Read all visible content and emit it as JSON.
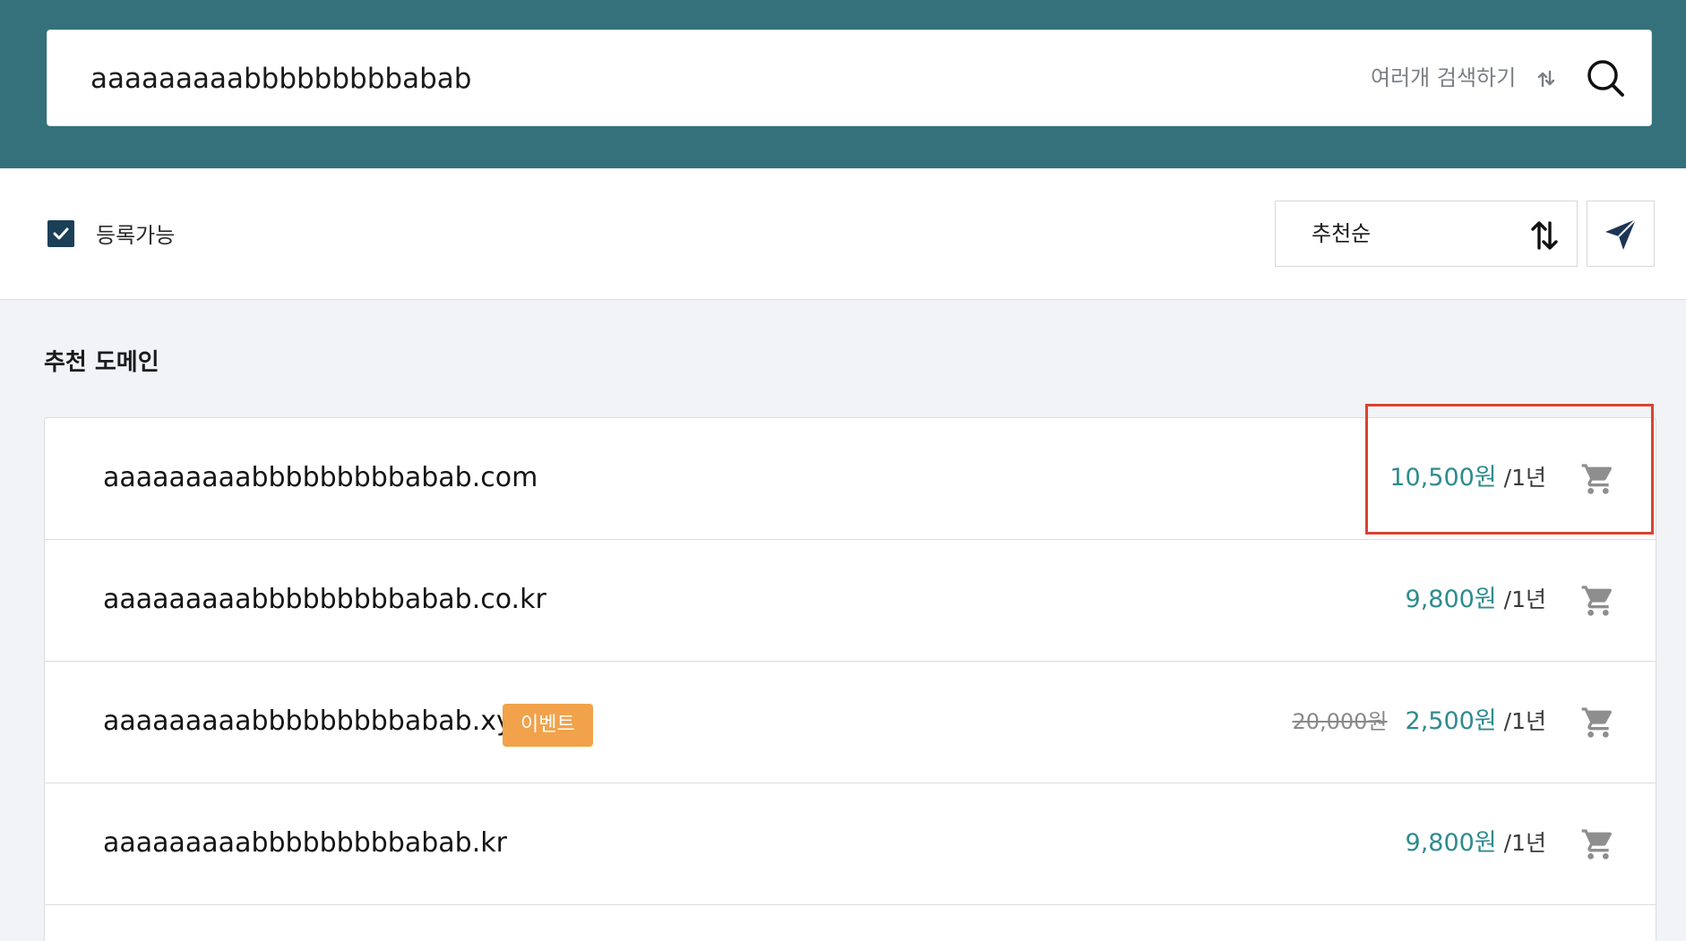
{
  "search": {
    "query": "aaaaaaaaabbbbbbbbbabab",
    "multi_search_label": "여러개 검색하기"
  },
  "filters": {
    "available_label": "등록가능",
    "available_checked": true,
    "sort_label": "추천순"
  },
  "section": {
    "title": "추천 도메인"
  },
  "domains": [
    {
      "name": "aaaaaaaaabbbbbbbbbabab.com",
      "old_price": "",
      "price": "10,500원",
      "period": "/1년",
      "badge": ""
    },
    {
      "name": "aaaaaaaaabbbbbbbbbabab.co.kr",
      "old_price": "",
      "price": "9,800원",
      "period": "/1년",
      "badge": ""
    },
    {
      "name": "aaaaaaaaabbbbbbbbbabab.xyz",
      "old_price": "20,000원",
      "price": "2,500원",
      "period": "/1년",
      "badge": "이벤트"
    },
    {
      "name": "aaaaaaaaabbbbbbbbbabab.kr",
      "old_price": "",
      "price": "9,800원",
      "period": "/1년",
      "badge": ""
    }
  ],
  "colors": {
    "header_bg": "#34717b",
    "price": "#2e8b8f",
    "badge": "#f1a24a",
    "highlight": "#d9432f",
    "checkbox": "#1c3f58"
  },
  "icons": [
    "swap-icon",
    "search-icon",
    "check-icon",
    "sort-icon",
    "send-icon",
    "cart-icon"
  ]
}
